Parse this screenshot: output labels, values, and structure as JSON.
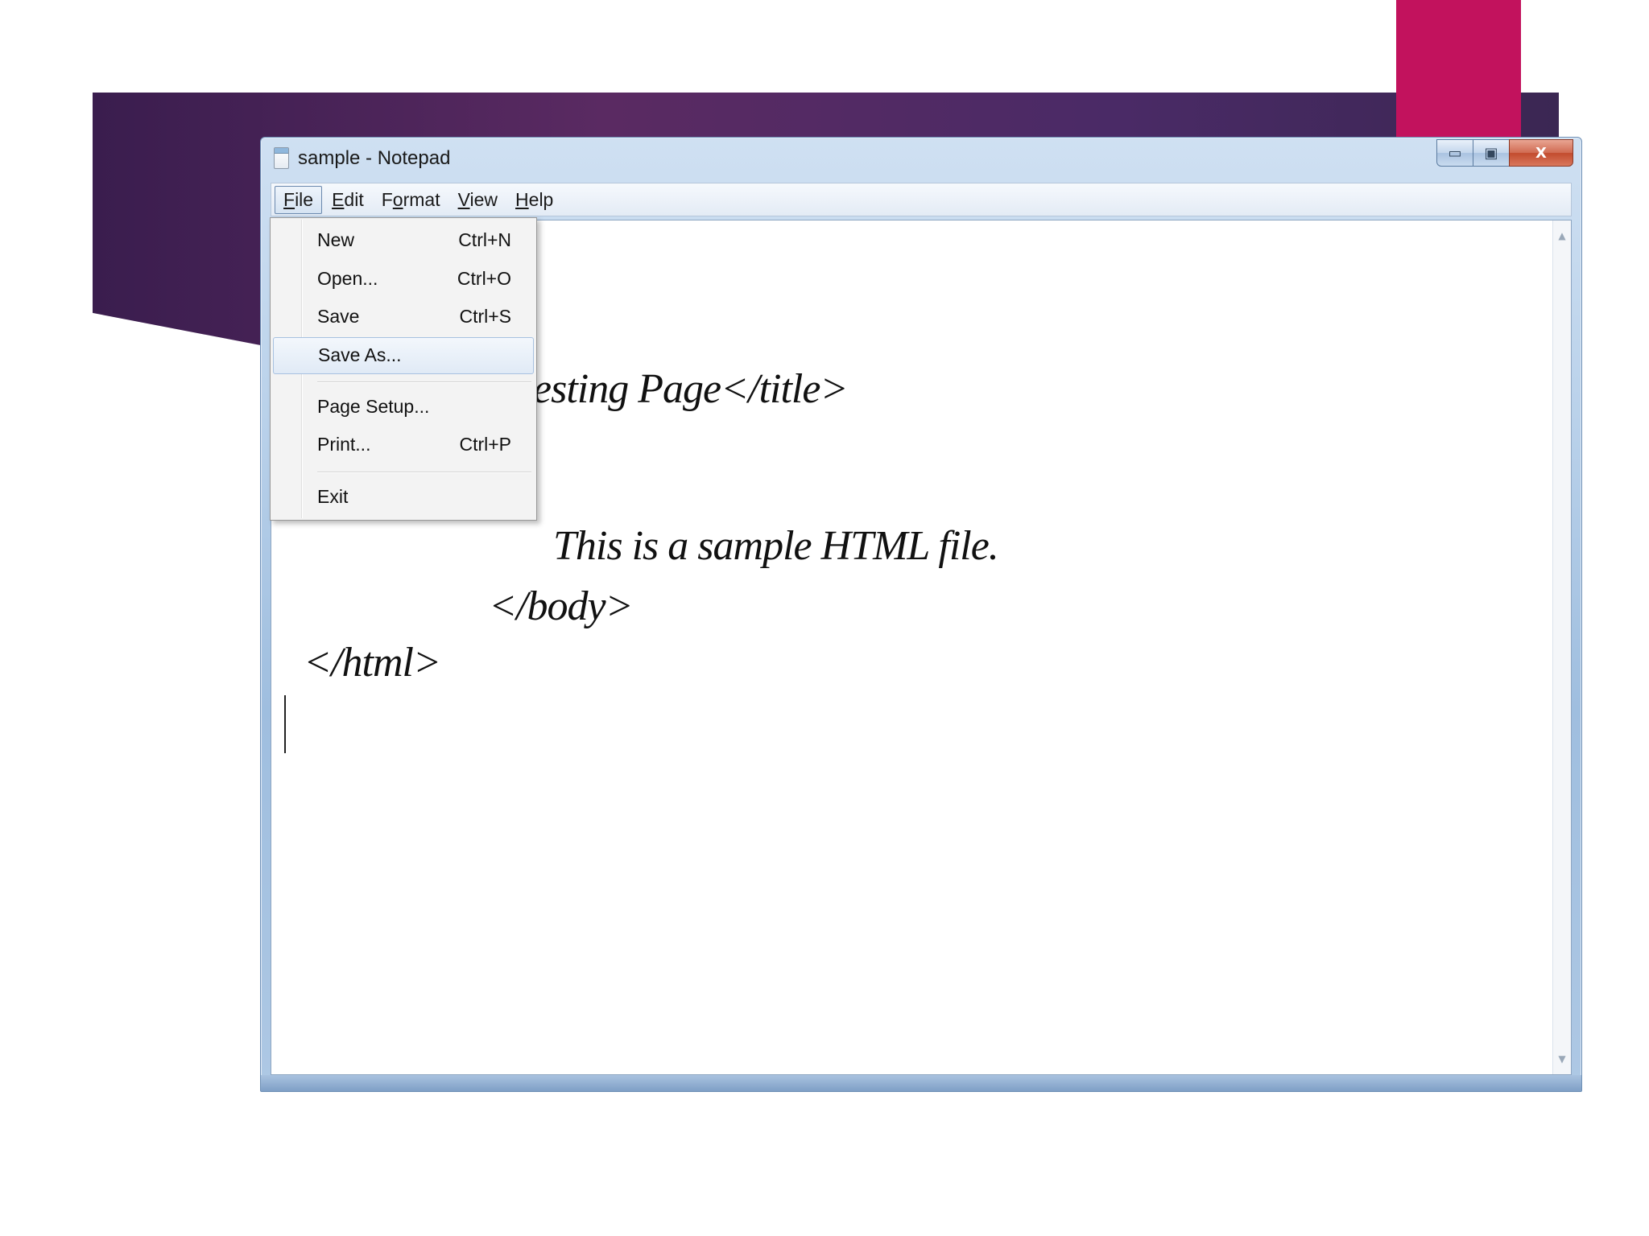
{
  "window": {
    "title": "sample - Notepad",
    "controls": {
      "minimize": "▭",
      "maximize": "▣",
      "close": "X"
    }
  },
  "menubar": {
    "file": {
      "mnemonic": "F",
      "rest": "ile"
    },
    "edit": {
      "mnemonic": "E",
      "rest": "dit"
    },
    "format": {
      "pre": "F",
      "mnemonic": "o",
      "rest": "rmat"
    },
    "view": {
      "mnemonic": "V",
      "rest": "iew"
    },
    "help": {
      "mnemonic": "H",
      "rest": "elp"
    }
  },
  "file_menu": {
    "items": [
      {
        "label": "New",
        "shortcut": "Ctrl+N"
      },
      {
        "label": "Open...",
        "shortcut": "Ctrl+O"
      },
      {
        "label": "Save",
        "shortcut": "Ctrl+S"
      },
      {
        "label": "Save As...",
        "shortcut": ""
      },
      {
        "label": "Page Setup...",
        "shortcut": ""
      },
      {
        "label": "Print...",
        "shortcut": "Ctrl+P"
      },
      {
        "label": "Exit",
        "shortcut": ""
      }
    ],
    "highlighted_item": "Save As..."
  },
  "editor": {
    "lines": [
      "esting Page</title>",
      "This is a sample HTML file.",
      "</body>",
      "</html>"
    ]
  },
  "scrollbar": {
    "up_arrow": "▲",
    "down_arrow": "▼"
  },
  "colors": {
    "banner_start": "#3a1d4e",
    "banner_end": "#3b2753",
    "accent": "#c2125d",
    "close_button": "#c24b2e"
  }
}
